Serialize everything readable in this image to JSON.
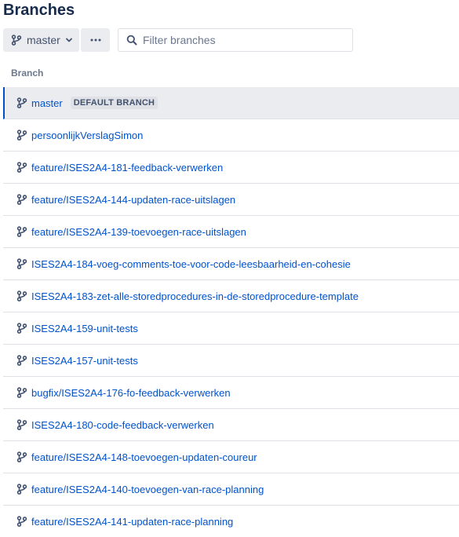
{
  "page": {
    "title": "Branches"
  },
  "toolbar": {
    "branch_selector_label": "master",
    "more_label": "•••"
  },
  "search": {
    "placeholder": "Filter branches"
  },
  "table": {
    "column_header": "Branch"
  },
  "default_badge": "DEFAULT BRANCH",
  "branches": [
    "master",
    "persoonlijkVerslagSimon",
    "feature/ISES2A4-181-feedback-verwerken",
    "feature/ISES2A4-144-updaten-race-uitslagen",
    "feature/ISES2A4-139-toevoegen-race-uitslagen",
    "ISES2A4-184-voeg-comments-toe-voor-code-leesbaarheid-en-cohesie",
    "ISES2A4-183-zet-alle-storedprocedures-in-de-storedprocedure-template",
    "ISES2A4-159-unit-tests",
    "ISES2A4-157-unit-tests",
    "bugfix/ISES2A4-176-fo-feedback-verwerken",
    "ISES2A4-180-code-feedback-verwerken",
    "feature/ISES2A4-148-toevoegen-updaten-coureur",
    "feature/ISES2A4-140-toevoegen-van-race-planning",
    "feature/ISES2A4-141-updaten-race-planning"
  ],
  "colors": {
    "link": "#0052cc",
    "text": "#172b4d",
    "muted": "#6b778c",
    "selected_bg": "#ebecf0",
    "border": "#dfe1e6"
  }
}
